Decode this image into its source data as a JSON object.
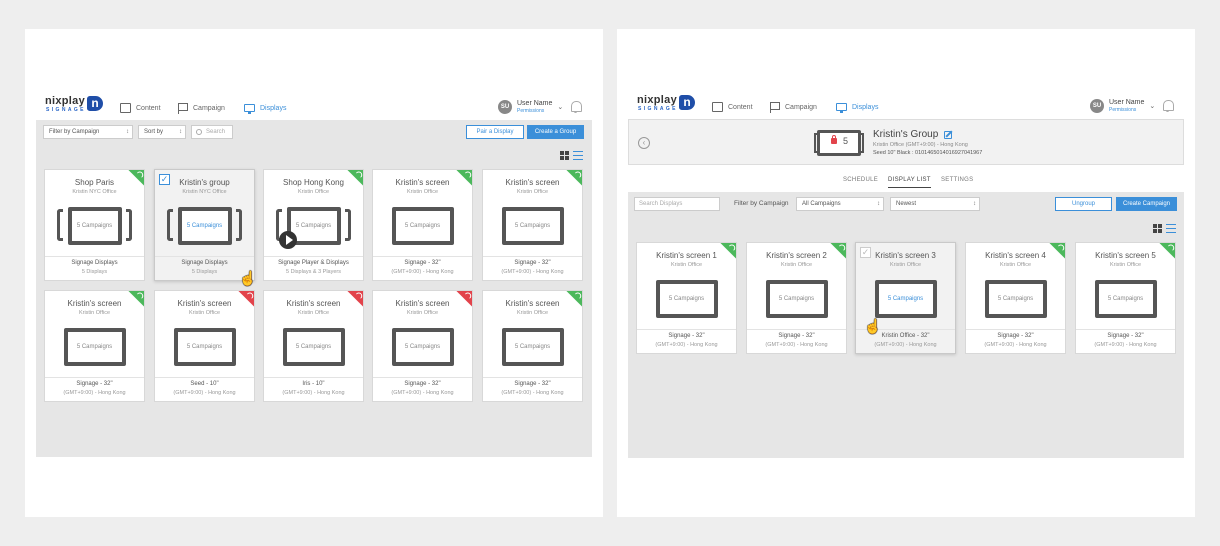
{
  "brand": {
    "word": "nixplay",
    "sub": "SIGNAGE",
    "badge": "n"
  },
  "nav": {
    "content": "Content",
    "campaign": "Campaign",
    "displays": "Displays"
  },
  "user": {
    "initials": "SU",
    "name": "User Name",
    "permissions": "Permissions"
  },
  "colors": {
    "accent": "#3b8fd9",
    "online": "#4cb85c",
    "offline": "#e2434b"
  },
  "left": {
    "filter_campaign": "Filter by Campaign",
    "sort_by": "Sort by",
    "search_placeholder": "Search",
    "pair_display": "Pair a Display",
    "create_group": "Create a Group",
    "cards": [
      {
        "title": "Shop Paris",
        "sub": "Kristin NYC Office",
        "screen": "5 Campaigns",
        "foot1": "Signage Displays",
        "foot2": "5 Displays",
        "status": "online"
      },
      {
        "title": "Kristin's group",
        "sub": "Kristin NYC Office",
        "screen": "5 Campaigns",
        "foot1": "Signage Displays",
        "foot2": "5 Displays",
        "status": "none"
      },
      {
        "title": "Shop Hong Kong",
        "sub": "Kristin Office",
        "screen": "5 Campaigns",
        "foot1": "Signage Player & Displays",
        "foot2": "5 Displays & 3 Players",
        "status": "online"
      },
      {
        "title": "Kristin's screen",
        "sub": "Kristin Office",
        "screen": "5 Campaigns",
        "foot1": "Signage - 32\"",
        "foot2": "(GMT+9:00) - Hong Kong",
        "status": "online"
      },
      {
        "title": "Kristin's screen",
        "sub": "Kristin Office",
        "screen": "5 Campaigns",
        "foot1": "Signage - 32\"",
        "foot2": "(GMT+9:00) - Hong Kong",
        "status": "online"
      },
      {
        "title": "Kristin's screen",
        "sub": "Kristin Office",
        "screen": "5 Campaigns",
        "foot1": "Signage - 32\"",
        "foot2": "(GMT+9:00) - Hong Kong",
        "status": "online"
      },
      {
        "title": "Kristin's screen",
        "sub": "Kristin Office",
        "screen": "5 Campaigns",
        "foot1": "Seed - 10\"",
        "foot2": "(GMT+9:00) - Hong Kong",
        "status": "offline"
      },
      {
        "title": "Kristin's screen",
        "sub": "Kristin Office",
        "screen": "5 Campaigns",
        "foot1": "Iris - 10\"",
        "foot2": "(GMT+9:00) - Hong Kong",
        "status": "offline"
      },
      {
        "title": "Kristin's screen",
        "sub": "Kristin Office",
        "screen": "5 Campaigns",
        "foot1": "Signage - 32\"",
        "foot2": "(GMT+9:00) - Hong Kong",
        "status": "offline"
      },
      {
        "title": "Kristin's screen",
        "sub": "Kristin Office",
        "screen": "5 Campaigns",
        "foot1": "Signage - 32\"",
        "foot2": "(GMT+9:00) - Hong Kong",
        "status": "online"
      }
    ]
  },
  "right": {
    "group": {
      "count": "5",
      "name": "Kristin's Group",
      "meta1": "Kristin Office (GMT+9:00) - Hong Kong",
      "meta2": "Seed 10\" Black  : 0101465014016927041967"
    },
    "tabs": {
      "schedule": "SCHEDULE",
      "display_list": "DISPLAY LIST",
      "settings": "SETTINGS"
    },
    "search_placeholder": "Search Displays",
    "filter_label": "Filter by Campaign",
    "campaign_select": "All Campaigns",
    "sort_select": "Newest",
    "ungroup": "Ungroup",
    "create_campaign": "Create Campaign",
    "cards": [
      {
        "title": "Kristin's screen 1",
        "sub": "Kristin Office",
        "screen": "5 Campaigns",
        "foot1": "Signage - 32\"",
        "foot2": "(GMT+9:00) - Hong Kong",
        "status": "online"
      },
      {
        "title": "Kristin's screen 2",
        "sub": "Kristin Office",
        "screen": "5 Campaigns",
        "foot1": "Signage - 32\"",
        "foot2": "(GMT+9:00) - Hong Kong",
        "status": "online"
      },
      {
        "title": "Kristin's screen 3",
        "sub": "Kristin Office",
        "screen": "5 Campaigns",
        "foot1": "Kristin Office - 32\"",
        "foot2": "(GMT+9:00) - Hong Kong",
        "status": "none"
      },
      {
        "title": "Kristin's screen 4",
        "sub": "Kristin Office",
        "screen": "5 Campaigns",
        "foot1": "Signage - 32\"",
        "foot2": "(GMT+9:00) - Hong Kong",
        "status": "online"
      },
      {
        "title": "Kristin's screen 5",
        "sub": "Kristin Office",
        "screen": "5 Campaigns",
        "foot1": "Signage - 32\"",
        "foot2": "(GMT+9:00) - Hong Kong",
        "status": "online"
      }
    ]
  }
}
